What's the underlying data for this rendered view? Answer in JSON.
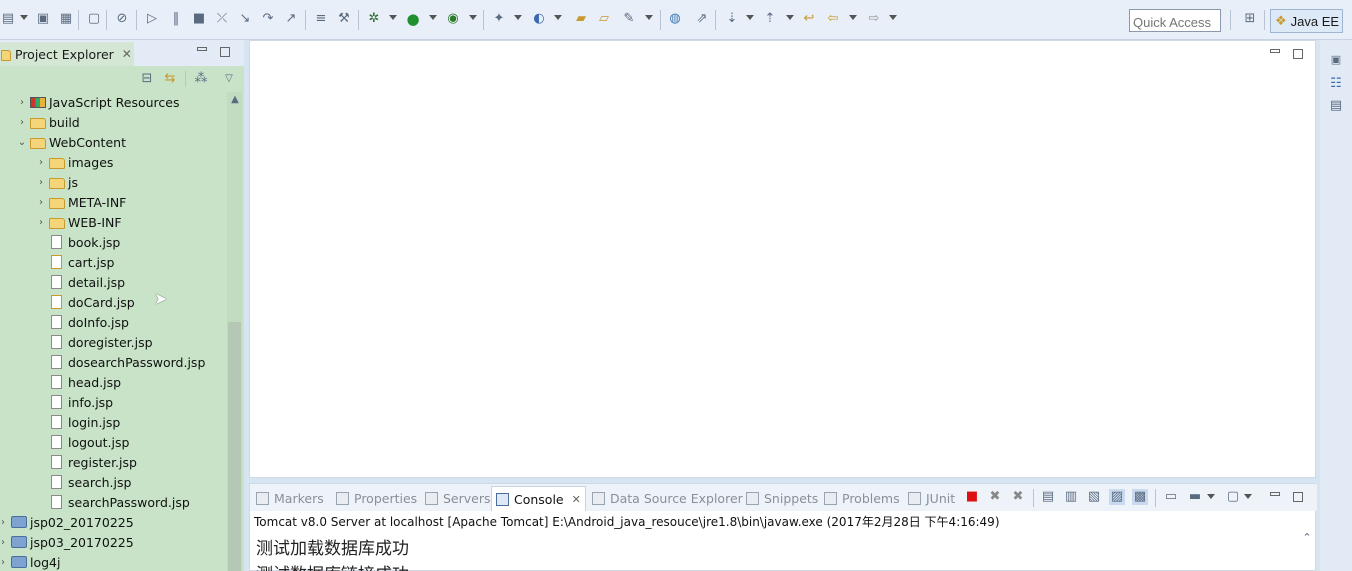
{
  "toolbar": {
    "quick_access_placeholder": "Quick Access",
    "perspective_label": "Java EE"
  },
  "project_explorer": {
    "title": "Project Explorer",
    "tree": [
      {
        "label": "JavaScript Resources",
        "icon": "javascript-resources-icon",
        "twisty": "›"
      },
      {
        "label": "build",
        "icon": "folder-icon",
        "twisty": "›"
      },
      {
        "label": "WebContent",
        "icon": "folder-open-icon",
        "twisty": "⌄"
      },
      {
        "label": "images",
        "icon": "folder-icon",
        "twisty": "›"
      },
      {
        "label": "js",
        "icon": "folder-icon",
        "twisty": "›"
      },
      {
        "label": "META-INF",
        "icon": "folder-icon",
        "twisty": "›"
      },
      {
        "label": "WEB-INF",
        "icon": "folder-icon",
        "twisty": "›"
      },
      {
        "label": "book.jsp",
        "icon": "jsp-file-icon"
      },
      {
        "label": "cart.jsp",
        "icon": "jsp-file-warning-icon"
      },
      {
        "label": "detail.jsp",
        "icon": "jsp-file-icon"
      },
      {
        "label": "doCard.jsp",
        "icon": "jsp-file-warning-icon"
      },
      {
        "label": "doInfo.jsp",
        "icon": "jsp-file-icon"
      },
      {
        "label": "doregister.jsp",
        "icon": "jsp-file-icon"
      },
      {
        "label": "dosearchPassword.jsp",
        "icon": "jsp-file-icon"
      },
      {
        "label": "head.jsp",
        "icon": "jsp-file-icon"
      },
      {
        "label": "info.jsp",
        "icon": "jsp-file-icon"
      },
      {
        "label": "login.jsp",
        "icon": "jsp-file-icon"
      },
      {
        "label": "logout.jsp",
        "icon": "jsp-file-icon"
      },
      {
        "label": "register.jsp",
        "icon": "jsp-file-icon"
      },
      {
        "label": "search.jsp",
        "icon": "jsp-file-icon"
      },
      {
        "label": "searchPassword.jsp",
        "icon": "jsp-file-icon"
      },
      {
        "label": "jsp02_20170225",
        "icon": "web-project-icon",
        "twisty": "›"
      },
      {
        "label": "jsp03_20170225",
        "icon": "web-project-icon",
        "twisty": "›"
      },
      {
        "label": "log4j",
        "icon": "web-project-icon",
        "twisty": "›"
      }
    ]
  },
  "console": {
    "tabs": [
      {
        "label": "Markers",
        "icon": "markers-icon"
      },
      {
        "label": "Properties",
        "icon": "properties-icon"
      },
      {
        "label": "Servers",
        "icon": "servers-icon"
      },
      {
        "label": "Console",
        "icon": "console-icon",
        "active": true
      },
      {
        "label": "Data Source Explorer",
        "icon": "data-source-icon"
      },
      {
        "label": "Snippets",
        "icon": "snippets-icon"
      },
      {
        "label": "Problems",
        "icon": "problems-icon"
      },
      {
        "label": "JUnit",
        "icon": "junit-icon"
      }
    ],
    "description": "Tomcat v8.0 Server at localhost [Apache Tomcat] E:\\Android_java_resouce\\jre1.8\\bin\\javaw.exe (2017年2月28日 下午4:16:49)",
    "lines": [
      "测试加载数据库成功",
      "测试数据库链接成功"
    ]
  }
}
